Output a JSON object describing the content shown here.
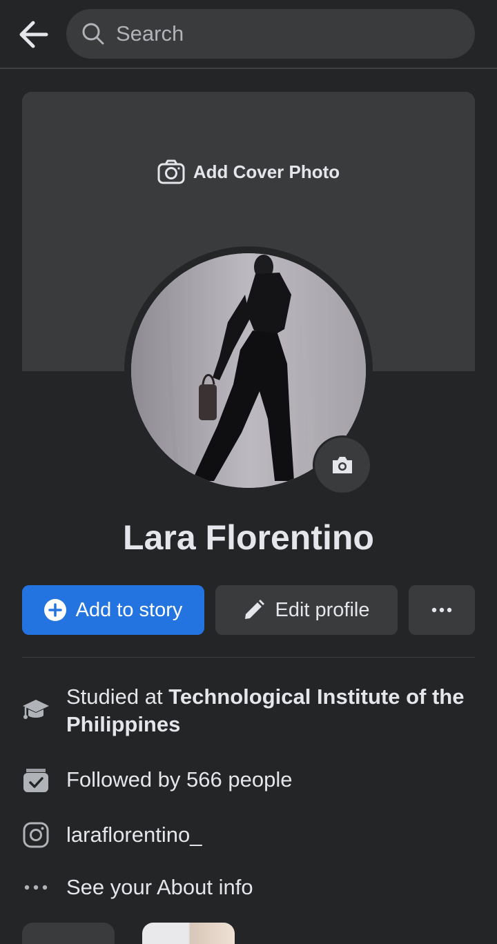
{
  "search": {
    "placeholder": "Search"
  },
  "cover": {
    "add_cover_label": "Add Cover Photo"
  },
  "profile": {
    "name": "Lara Florentino"
  },
  "actions": {
    "add_story_label": "Add to story",
    "edit_profile_label": "Edit profile",
    "more_icon": "more-dots-icon"
  },
  "intro": {
    "education_prefix": "Studied at ",
    "education_school": "Technological Institute of the Philippines",
    "followers": "Followed by 566 people",
    "instagram": "laraflorentino_",
    "about": "See your About info"
  },
  "colors": {
    "background": "#242526",
    "surface": "#3a3b3c",
    "primary": "#2374e1",
    "text": "#e4e6eb"
  }
}
